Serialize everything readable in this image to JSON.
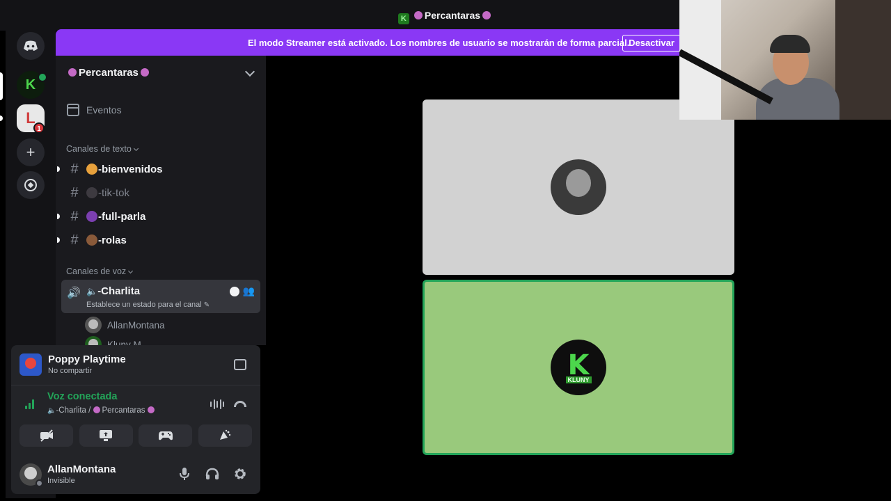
{
  "window": {
    "title": "Percantaras",
    "server_icon_letter": "K"
  },
  "banner": {
    "text": "El modo Streamer está activado. Los nombres de usuario se mostrarán de forma parcial.",
    "button_label": "Desactivar"
  },
  "server_rail": {
    "notification_badge": "1"
  },
  "server": {
    "name": "Percantaras",
    "events_label": "Eventos"
  },
  "categories": {
    "text_label": "Canales de texto",
    "voice_label": "Canales de voz"
  },
  "text_channels": [
    {
      "name": "-bienvenidos",
      "emoji_color": "#e8a13c"
    },
    {
      "name": "-tik-tok",
      "emoji_color": "#3d3a40"
    },
    {
      "name": "-full-parla",
      "emoji_color": "#7b3fb0"
    },
    {
      "name": "-rolas",
      "emoji_color": "#8a5a3a"
    }
  ],
  "voice_channel": {
    "name": "-Charlita",
    "status": "Establece un estado para el canal",
    "members": [
      "AllanMontana",
      "Kluny M"
    ]
  },
  "activity": {
    "title": "Poppy Playtime",
    "subtitle": "No compartir"
  },
  "voice_connection": {
    "title": "Voz conectada",
    "channel": "-Charlita / ",
    "server": "Percantaras"
  },
  "user": {
    "name": "AllanMontana",
    "status": "Invisible"
  },
  "stage": {
    "tile2_logo_letter": "K",
    "tile2_logo_text": "KLUNY"
  },
  "colors": {
    "banner": "#8a38f5",
    "connected_green": "#23a559",
    "speaking_tile": "#99c97c"
  }
}
